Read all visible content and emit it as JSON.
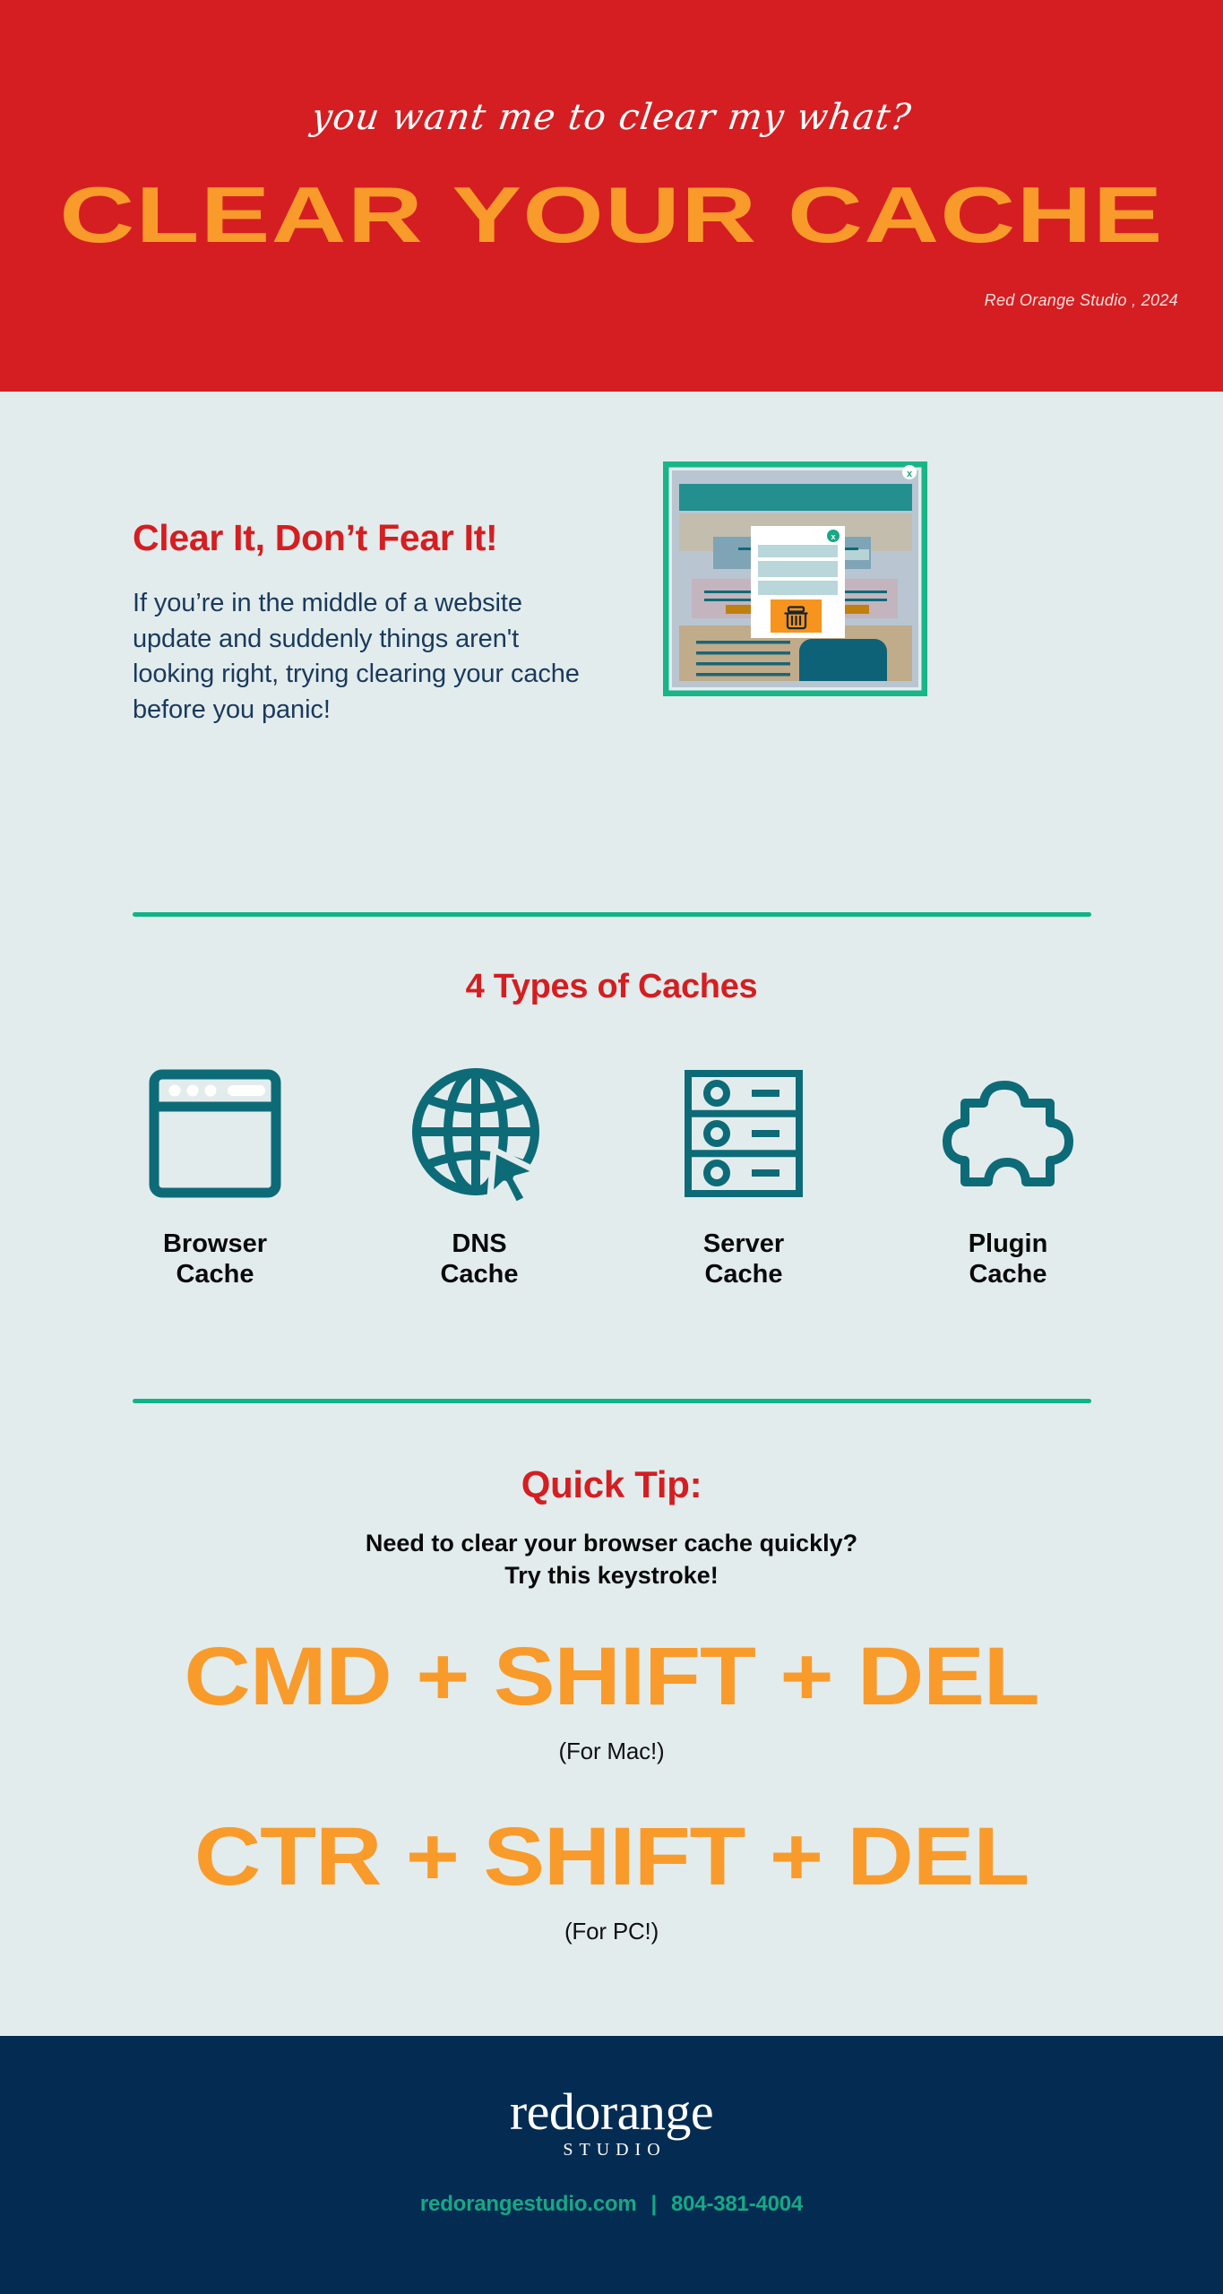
{
  "colors": {
    "header_red": "#d51e21",
    "accent_orange": "#f99b2b",
    "page_bg": "#e3eced",
    "teal": "#0d6b78",
    "green_rule": "#0fb388",
    "footer_navy": "#042c52",
    "footer_link_green": "#17a884",
    "body_navy": "#1a3a5c"
  },
  "header": {
    "script_line": "you want me to clear my what?",
    "title": "CLEAR YOUR CACHE",
    "credit": "Red Orange Studio , 2024"
  },
  "intro": {
    "heading": "Clear It, Don’t Fear It!",
    "body": "If you’re in the middle of a website update and suddenly things aren't looking right, trying clearing your cache before you panic!"
  },
  "mockup": {
    "browser_close_label": "x",
    "modal_close_label": "x",
    "modal_action_icon": "trash-icon"
  },
  "cache_types": {
    "title": "4 Types of Caches",
    "items": [
      {
        "icon": "browser-window-icon",
        "label": "Browser\nCache"
      },
      {
        "icon": "globe-cursor-icon",
        "label": "DNS\nCache"
      },
      {
        "icon": "server-rack-icon",
        "label": "Server\nCache"
      },
      {
        "icon": "puzzle-piece-icon",
        "label": "Plugin\nCache"
      }
    ]
  },
  "quick_tip": {
    "title": "Quick Tip:",
    "subtitle": "Need to clear your browser cache quickly?\nTry this keystroke!",
    "shortcuts": [
      {
        "keys": "CMD + SHIFT + DEL",
        "platform": "(For Mac!)"
      },
      {
        "keys": "CTR + SHIFT + DEL",
        "platform": "(For PC!)"
      }
    ]
  },
  "footer": {
    "logo_word": "redorange",
    "logo_sub": "STUDIO",
    "website": "redorangestudio.com",
    "separator": "|",
    "phone": "804-381-4004"
  }
}
